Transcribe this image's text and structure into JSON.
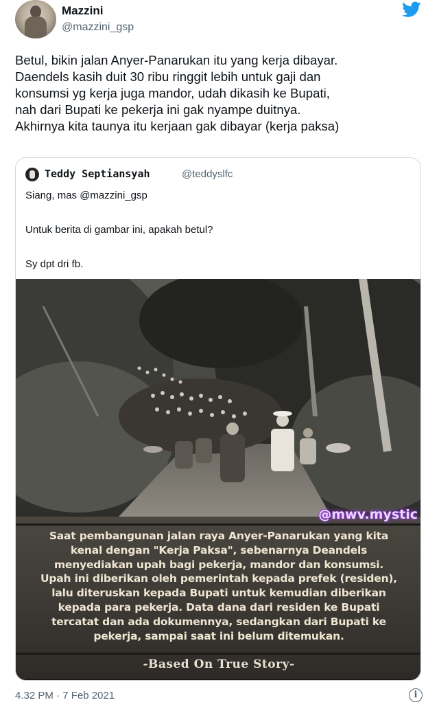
{
  "author": {
    "display_name": "Mazzini",
    "handle": "@mazzini_gsp"
  },
  "icons": {
    "platform": "twitter-bird-icon",
    "info": "info-icon"
  },
  "colors": {
    "brand": "#1d9bf0",
    "secondary_text": "#536471",
    "border": "#cfd9de"
  },
  "tweet": {
    "lines": [
      "Betul, bikin jalan Anyer-Panarukan itu yang kerja dibayar.",
      "Daendels kasih duit 30 ribu ringgit lebih untuk gaji dan",
      "konsumsi yg kerja juga mandor, udah dikasih ke Bupati,",
      "nah dari Bupati ke pekerja ini gak nyampe duitnya.",
      "Akhirnya kita taunya itu kerjaan gak dibayar (kerja paksa)"
    ],
    "timestamp": "4.32 PM · 7 Feb 2021"
  },
  "quoted": {
    "display_name": "Teddy Septiansyah",
    "handle": "@teddyslfc",
    "text_lines": [
      "Siang, mas @mazzini_gsp",
      "Untuk berita di gambar ini, apakah betul?",
      "Sy dpt dri fb."
    ],
    "image": {
      "watermark": "@mwv.mystic",
      "caption_lines": [
        "Saat pembangunan jalan raya Anyer-Panarukan yang kita",
        "kenal dengan \"Kerja Paksa\", sebenarnya Deandels",
        "menyediakan upah bagi pekerja, mandor dan konsumsi.",
        "Upah ini diberikan oleh pemerintah kepada prefek (residen),",
        "lalu diteruskan kepada Bupati untuk kemudian diberikan",
        "kepada para pekerja. Data dana dari residen ke Bupati",
        "tercatat dan ada dokumennya, sedangkan dari Bupati ke",
        "pekerja, sampai saat ini belum ditemukan."
      ],
      "footer": "-Based On True Story-"
    }
  }
}
